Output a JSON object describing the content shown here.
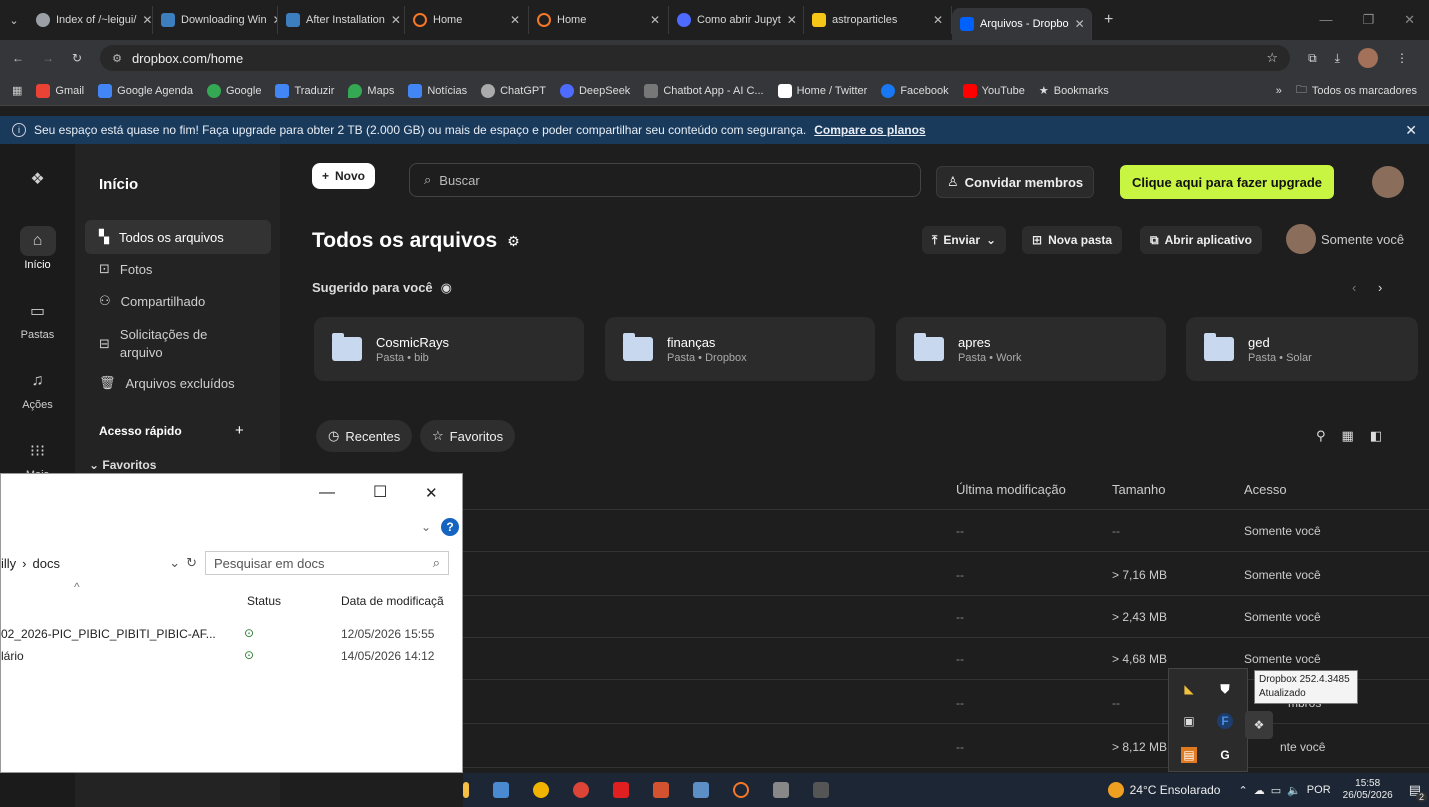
{
  "browser": {
    "tabs": [
      {
        "label": "Index of /~leigui/",
        "icon_color": "#9aa0a6"
      },
      {
        "label": "Downloading Win",
        "icon_color": "#3d7ebf"
      },
      {
        "label": "After Installation",
        "icon_color": "#3d7ebf"
      },
      {
        "label": "Home",
        "icon_color": "#f37726"
      },
      {
        "label": "Home",
        "icon_color": "#f37726"
      },
      {
        "label": "Como abrir Jupyt",
        "icon_color": "#4d6bfe"
      },
      {
        "label": "astroparticles",
        "icon_color": "#f5c518"
      },
      {
        "label": "Arquivos - Dropbo",
        "icon_color": "#0061fe"
      }
    ],
    "url": "dropbox.com/home",
    "bookmarks": [
      {
        "label": "Gmail",
        "color": "#ea4335"
      },
      {
        "label": "Google Agenda",
        "color": "#4285f4"
      },
      {
        "label": "Google",
        "color": "#34a853"
      },
      {
        "label": "Traduzir",
        "color": "#4285f4"
      },
      {
        "label": "Maps",
        "color": "#34a853"
      },
      {
        "label": "Notícias",
        "color": "#4285f4"
      },
      {
        "label": "ChatGPT",
        "color": "#aaaaaa"
      },
      {
        "label": "DeepSeek",
        "color": "#4d6bfe"
      },
      {
        "label": "Chatbot App - AI C...",
        "color": "#777777"
      },
      {
        "label": "Home / Twitter",
        "color": "#ffffff"
      },
      {
        "label": "Facebook",
        "color": "#1877f2"
      },
      {
        "label": "YouTube",
        "color": "#ff0000"
      },
      {
        "label": "Bookmarks",
        "color": "#dddddd"
      }
    ],
    "all_bookmarks": "Todos os marcadores",
    "chevrons": "»"
  },
  "banner": {
    "text": "Seu espaço está quase no fim! Faça upgrade para obter 2 TB (2.000 GB) ou mais de espaço e poder compartilhar seu conteúdo com segurança.",
    "link": "Compare os planos"
  },
  "rail": {
    "items": [
      "Início",
      "Pastas",
      "Ações",
      "Mais"
    ]
  },
  "sidebar": {
    "title": "Início",
    "items": [
      "Todos os arquivos",
      "Fotos",
      "Compartilhado",
      "Solicitações de",
      "arquivo",
      "Arquivos excluídos"
    ],
    "quick_access": "Acesso rápido",
    "plus": "+",
    "favorites": "Favoritos"
  },
  "header": {
    "new_label": "Novo",
    "search_placeholder": "Buscar",
    "invite": "Convidar membros",
    "upgrade": "Clique aqui para fazer upgrade"
  },
  "main": {
    "title": "Todos os arquivos",
    "send": "Enviar",
    "new_folder": "Nova pasta",
    "open_app": "Abrir aplicativo",
    "only_you": "Somente você",
    "suggested": "Sugerido para você",
    "cards": [
      {
        "name": "CosmicRays",
        "sub": "Pasta • bib"
      },
      {
        "name": "finanças",
        "sub": "Pasta • Dropbox"
      },
      {
        "name": "apres",
        "sub": "Pasta • Work"
      },
      {
        "name": "ged",
        "sub": "Pasta • Solar"
      }
    ],
    "chip_recent": "Recentes",
    "chip_fav": "Favoritos",
    "columns": {
      "modified": "Última modificação",
      "size": "Tamanho",
      "access": "Acesso"
    },
    "rows": [
      {
        "mod": "--",
        "size": "--",
        "access": "Somente você"
      },
      {
        "mod": "--",
        "size": "> 7,16 MB",
        "access": "Somente você"
      },
      {
        "mod": "--",
        "size": "> 2,43 MB",
        "access": "Somente você"
      },
      {
        "mod": "--",
        "size": "> 4,68 MB",
        "access": "Somente você"
      },
      {
        "mod": "--",
        "size": "--",
        "access": "mbros"
      },
      {
        "mod": "--",
        "size": "> 8,12 MB",
        "access": "nte você"
      }
    ]
  },
  "explorer": {
    "path_a": "illy",
    "path_sep": "›",
    "path_b": "docs",
    "search_placeholder": "Pesquisar em docs",
    "col_status": "Status",
    "col_date": "Data de modificaçã",
    "files": [
      {
        "name": "02_2026-PIC_PIBIC_PIBITI_PIBIC-AF...",
        "date": "12/05/2026 15:55"
      },
      {
        "name": "lário",
        "date": "14/05/2026 14:12"
      }
    ],
    "minimize": "—",
    "maximize": "☐",
    "close": "✕",
    "help": "?"
  },
  "tooltip": {
    "line1": "Dropbox 252.4.3485",
    "line2": "Atualizado"
  },
  "taskbar": {
    "weather": "24°C Ensolarado",
    "lang": "POR",
    "time": "15:58",
    "date": "26/05/2026",
    "badge": "2"
  }
}
